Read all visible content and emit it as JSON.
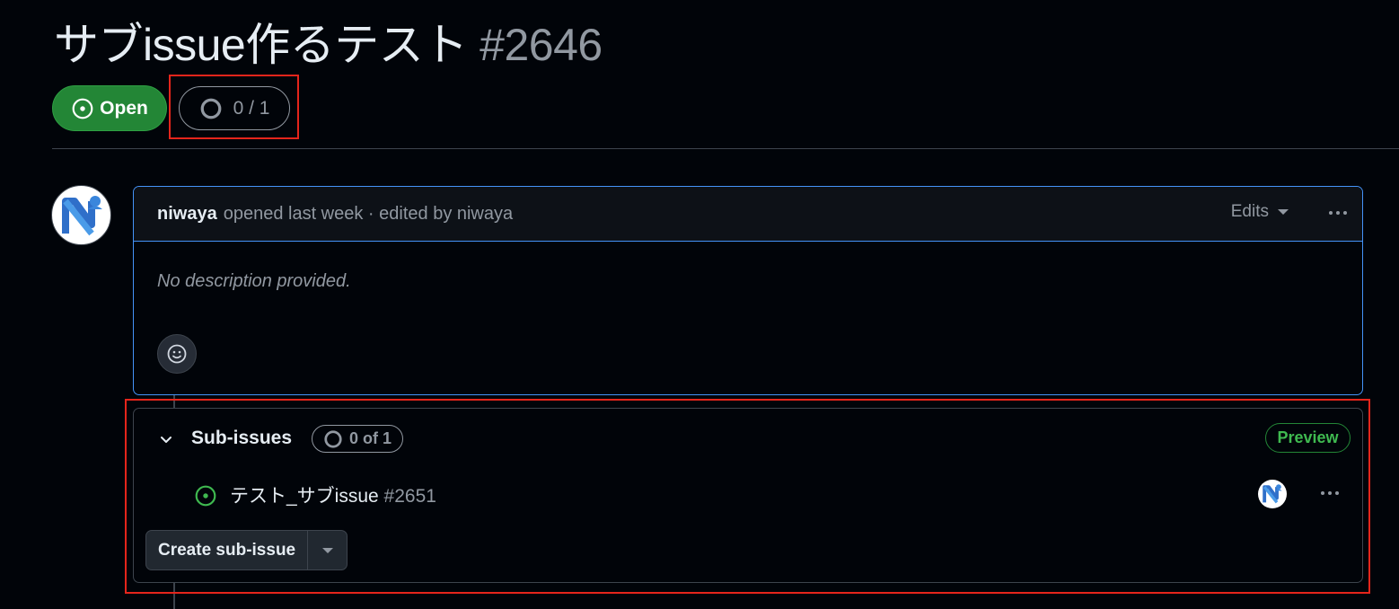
{
  "issue": {
    "title": "サブissue作るテスト",
    "number": "#2646",
    "state_label": "Open",
    "progress": "0 / 1"
  },
  "comment": {
    "author": "niwaya",
    "meta": "opened last week · edited by niwaya",
    "edits_label": "Edits",
    "body": "No description provided."
  },
  "sub_issues": {
    "title": "Sub-issues",
    "counter": "0 of 1",
    "badge": "Preview",
    "items": [
      {
        "title": "テスト_サブissue",
        "number": "#2651",
        "state": "open"
      }
    ],
    "create_label": "Create sub-issue"
  },
  "colors": {
    "open_green": "#238636",
    "accent_blue": "#4493f8",
    "highlight_red": "#e5251b",
    "background": "#010409"
  },
  "icons": [
    "issue-open-icon",
    "progress-circle-icon",
    "caret-down-icon",
    "kebab-icon",
    "smiley-icon",
    "chevron-down-icon",
    "avatar"
  ]
}
